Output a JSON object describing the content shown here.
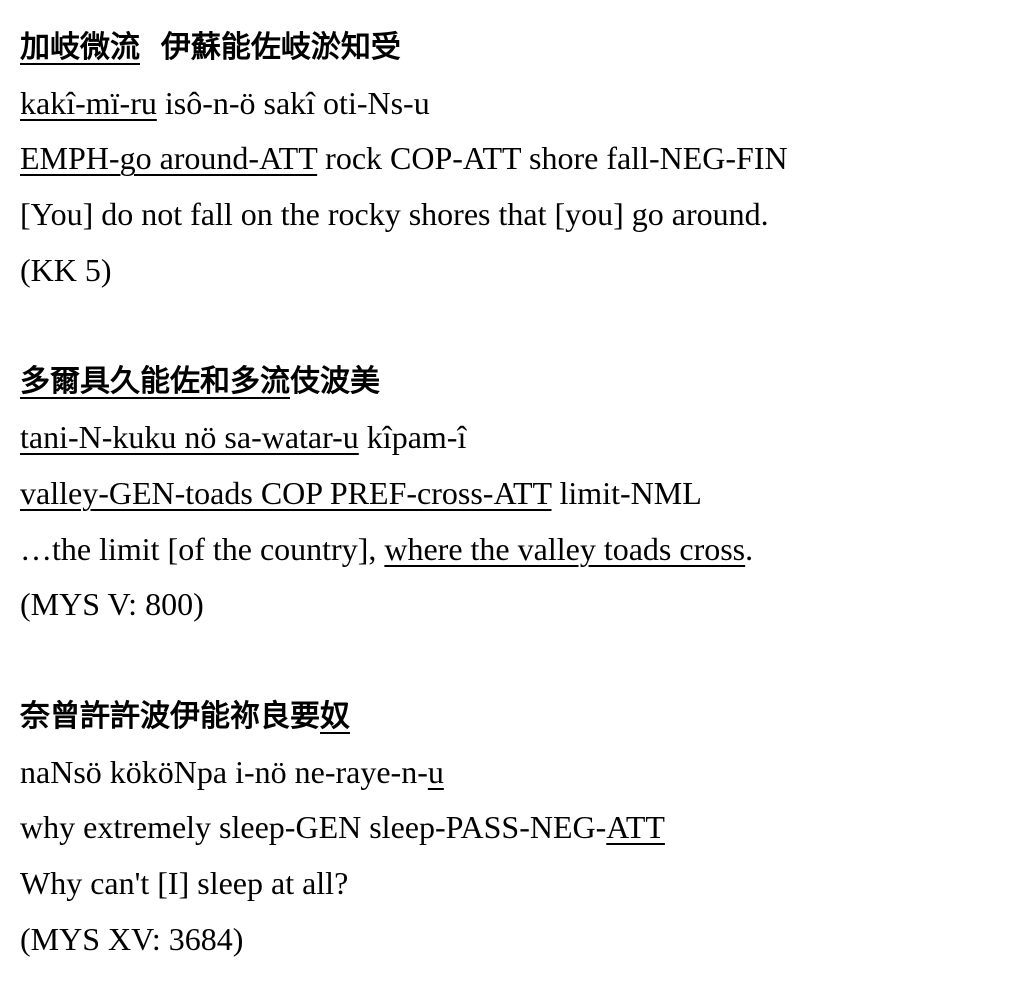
{
  "examples": [
    {
      "script": [
        {
          "text": "加岐微流",
          "u": true
        },
        {
          "text": "  伊蘇能佐岐淤知受",
          "u": false
        }
      ],
      "transliteration": [
        {
          "text": "kakî-mï-ru",
          "u": true
        },
        {
          "text": " isô-n-ö sakî oti-Ns-u",
          "u": false
        }
      ],
      "gloss": [
        {
          "text": "EMPH-go around-ATT",
          "u": true
        },
        {
          "text": " rock COP-ATT shore fall-NEG-FIN",
          "u": false
        }
      ],
      "translation": [
        {
          "text": "[You] do not fall on the rocky shores that [you] go around.",
          "u": false
        }
      ],
      "source": "(KK 5)"
    },
    {
      "script": [
        {
          "text": "多爾具久能佐和多流",
          "u": true
        },
        {
          "text": "伎波美",
          "u": false
        }
      ],
      "transliteration": [
        {
          "text": "tani-N-kuku nö sa-watar-u",
          "u": true
        },
        {
          "text": " kîpam-î",
          "u": false
        }
      ],
      "gloss": [
        {
          "text": "valley-GEN-toads COP PREF-cross-ATT",
          "u": true
        },
        {
          "text": " limit-NML",
          "u": false
        }
      ],
      "translation": [
        {
          "text": "…the limit [of the country], ",
          "u": false
        },
        {
          "text": "where the valley toads cross",
          "u": true
        },
        {
          "text": ".",
          "u": false
        }
      ],
      "source": "(MYS V: 800)"
    },
    {
      "script": [
        {
          "text": "奈曾許許波伊能祢良要",
          "u": false
        },
        {
          "text": "奴",
          "u": true
        }
      ],
      "transliteration": [
        {
          "text": "naNsö kököNpa i-nö ne-raye-n-",
          "u": false
        },
        {
          "text": "u",
          "u": true
        }
      ],
      "gloss": [
        {
          "text": "why extremely sleep-GEN sleep-PASS-NEG-",
          "u": false
        },
        {
          "text": "ATT",
          "u": true
        }
      ],
      "translation": [
        {
          "text": "Why can't [I] sleep at all?",
          "u": false
        }
      ],
      "source": "(MYS XV: 3684)"
    }
  ]
}
